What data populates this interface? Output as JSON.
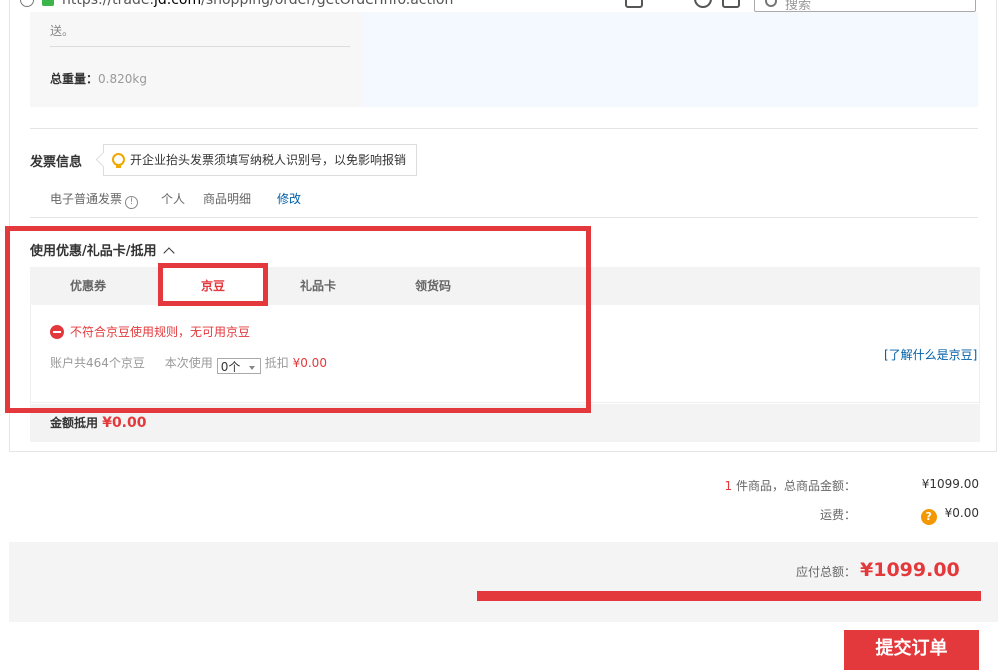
{
  "browser": {
    "url_prefix": "https://trade.",
    "url_domain": "jd.com",
    "url_path": "/shopping/order/getOrderInfo.action",
    "search_placeholder": "搜索"
  },
  "shipping": {
    "note_tail": "送。",
    "weight_label": "总重量：",
    "weight_value": "0.820kg"
  },
  "invoice": {
    "title": "发票信息",
    "tip": "开企业抬头发票须填写纳税人识别号，以免影响报销",
    "type": "电子普通发票",
    "info_glyph": "!",
    "header": "个人",
    "content": "商品明细",
    "modify_link": "修改"
  },
  "coupons": {
    "title": "使用优惠/礼品卡/抵用",
    "tabs": [
      "优惠券",
      "京豆",
      "礼品卡",
      "领货码"
    ],
    "active_tab": 1,
    "warning": "不符合京豆使用规则，无可用京豆",
    "account_text": "账户共464个京豆",
    "use_label": "本次使用",
    "use_select_value": "0个",
    "deduct_label": "抵扣",
    "deduct_value": "¥0.00",
    "whatis_link": "[了解什么是京豆]",
    "amount_label": "金额抵用",
    "amount_value": "¥0.00"
  },
  "summary": {
    "item_count": "1",
    "items_label": "件商品，总商品金额：",
    "items_total": "¥1099.00",
    "freight_label": "运费：",
    "freight_help_glyph": "?",
    "freight_value": "¥0.00",
    "payable_label": "应付总额：",
    "payable_value": "¥1099.00"
  },
  "submit_label": "提交订单",
  "colors": {
    "accent": "#e4393c",
    "link": "#005ea7",
    "annotation_red": "#e4393c"
  }
}
